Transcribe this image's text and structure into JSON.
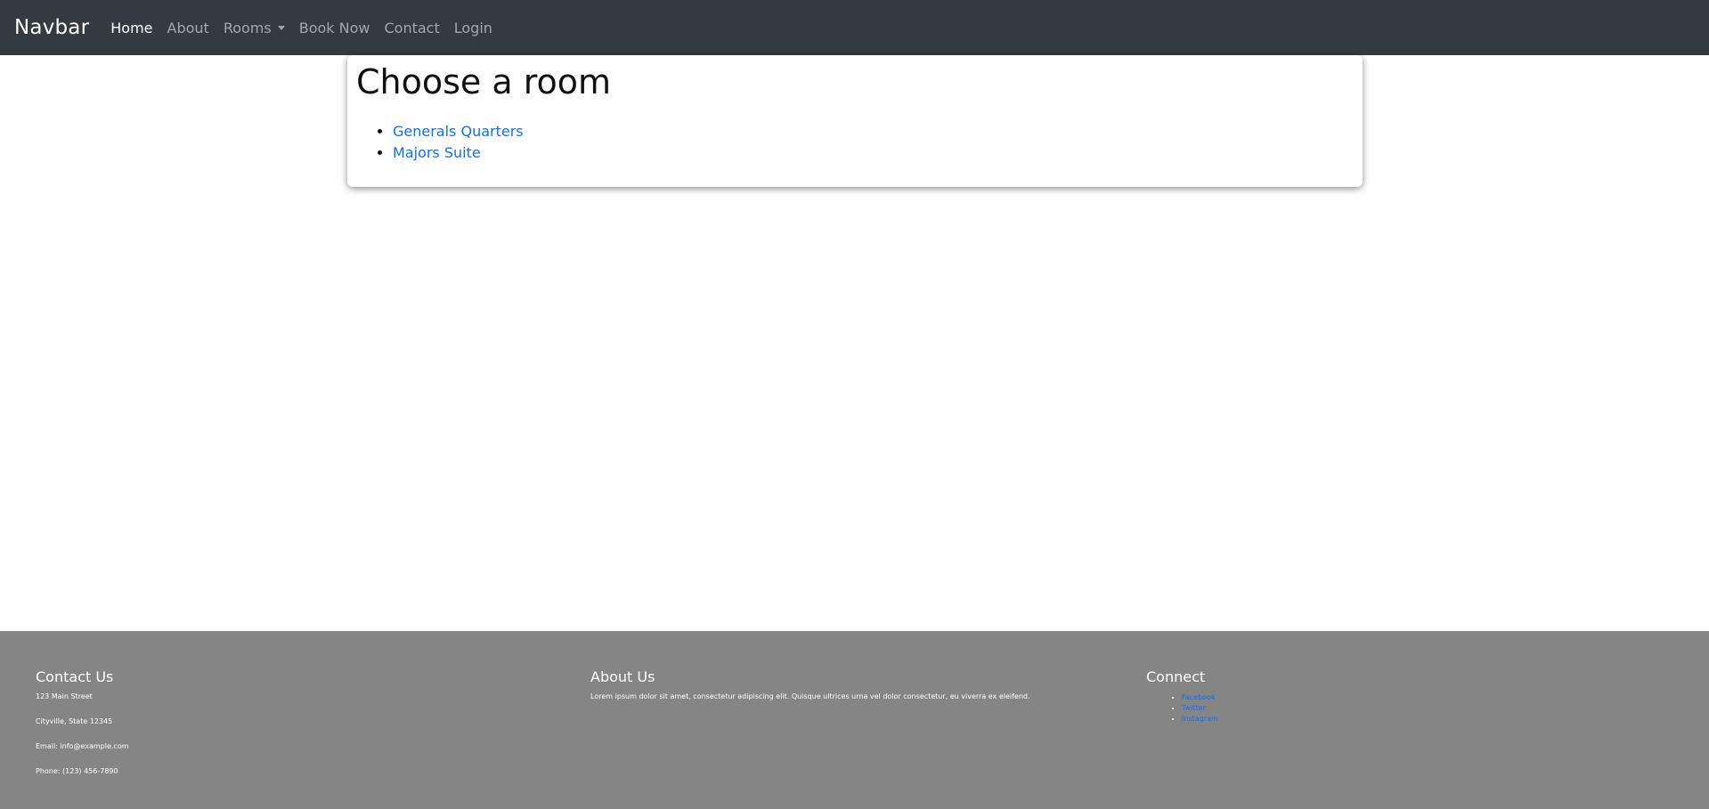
{
  "navbar": {
    "brand": "Navbar",
    "links": [
      {
        "label": "Home",
        "active": true
      },
      {
        "label": "About"
      },
      {
        "label": "Rooms",
        "dropdown": true
      },
      {
        "label": "Book Now"
      },
      {
        "label": "Contact"
      },
      {
        "label": "Login"
      }
    ]
  },
  "main": {
    "title": "Choose a room",
    "rooms": [
      "Generals Quarters",
      "Majors Suite"
    ]
  },
  "footer": {
    "contact": {
      "title": "Contact Us",
      "lines": [
        "123 Main Street",
        "Cityville, State 12345",
        "Email: info@example.com",
        "Phone: (123) 456-7890"
      ]
    },
    "about": {
      "title": "About Us",
      "text": "Lorem ipsum dolor sit amet, consectetur adipiscing elit. Quisque ultrices urna vel dolor consectetur, eu viverra ex eleifend."
    },
    "connect": {
      "title": "Connect",
      "links": [
        "Facebook",
        "Twitter",
        "Instagram"
      ]
    }
  },
  "colors": {
    "navbar_bg": "#343a40",
    "footer_bg": "#858585",
    "link": "#0d6efd"
  }
}
